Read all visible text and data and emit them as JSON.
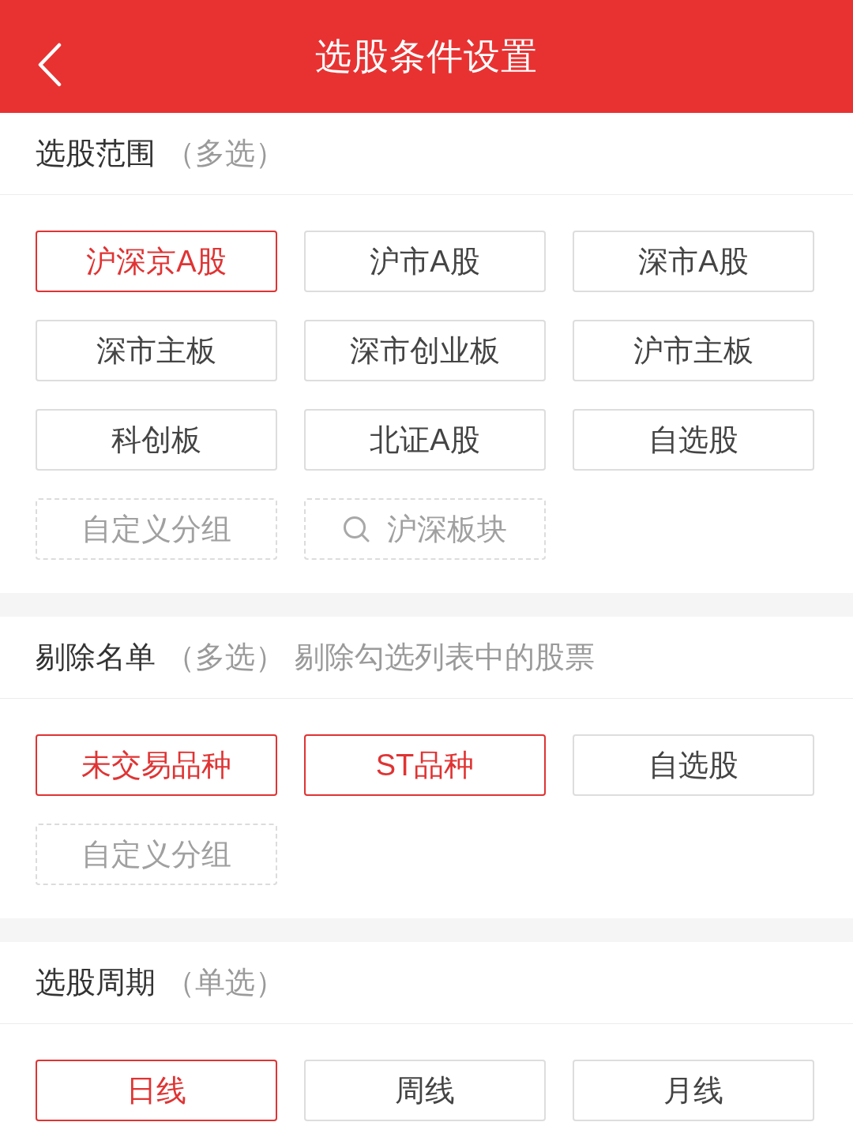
{
  "header": {
    "title": "选股条件设置"
  },
  "sections": [
    {
      "title": "选股范围",
      "note": "（多选）",
      "options": [
        {
          "label": "沪深京A股",
          "kind": "option",
          "selected": true
        },
        {
          "label": "沪市A股",
          "kind": "option",
          "selected": false
        },
        {
          "label": "深市A股",
          "kind": "option",
          "selected": false
        },
        {
          "label": "深市主板",
          "kind": "option",
          "selected": false
        },
        {
          "label": "深市创业板",
          "kind": "option",
          "selected": false
        },
        {
          "label": "沪市主板",
          "kind": "option",
          "selected": false
        },
        {
          "label": "科创板",
          "kind": "option",
          "selected": false
        },
        {
          "label": "北证A股",
          "kind": "option",
          "selected": false
        },
        {
          "label": "自选股",
          "kind": "option",
          "selected": false
        },
        {
          "label": "自定义分组",
          "kind": "custom",
          "selected": false
        },
        {
          "label": "沪深板块",
          "kind": "search",
          "selected": false
        }
      ]
    },
    {
      "title": "剔除名单",
      "note": "（多选）",
      "hint": "剔除勾选列表中的股票",
      "options": [
        {
          "label": "未交易品种",
          "kind": "option",
          "selected": true
        },
        {
          "label": "ST品种",
          "kind": "option",
          "selected": true
        },
        {
          "label": "自选股",
          "kind": "option",
          "selected": false
        },
        {
          "label": "自定义分组",
          "kind": "custom",
          "selected": false
        }
      ]
    },
    {
      "title": "选股周期",
      "note": "（单选）",
      "options": [
        {
          "label": "日线",
          "kind": "option",
          "selected": true
        },
        {
          "label": "周线",
          "kind": "option",
          "selected": false
        },
        {
          "label": "月线",
          "kind": "option",
          "selected": false
        }
      ]
    }
  ]
}
